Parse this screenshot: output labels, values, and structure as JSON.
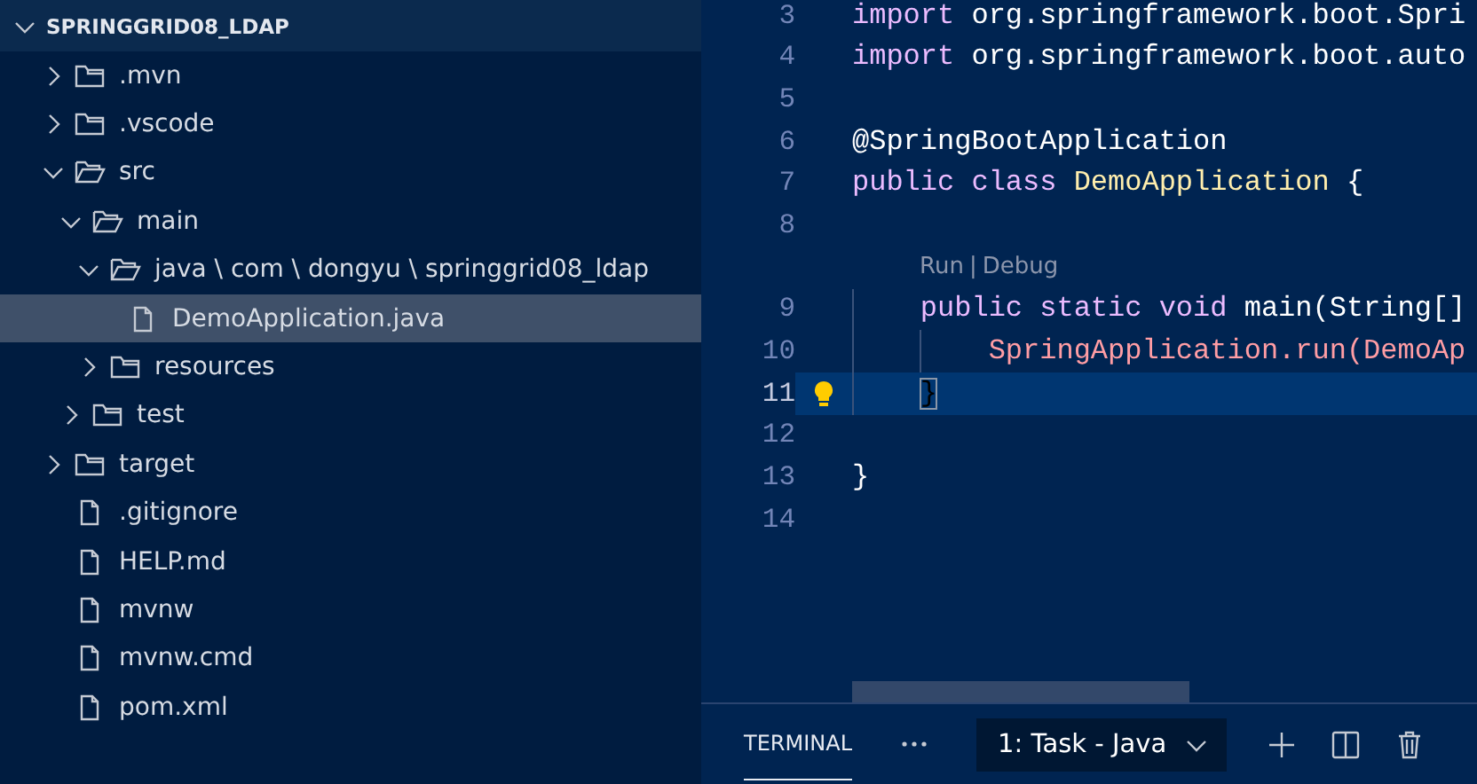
{
  "explorer": {
    "title": "SPRINGGRID08_LDAP",
    "expanded": true,
    "items": [
      {
        "kind": "folder",
        "label": ".mvn",
        "expanded": false,
        "selected": false
      },
      {
        "kind": "folder",
        "label": ".vscode",
        "expanded": false,
        "selected": false
      },
      {
        "kind": "folder",
        "label": "src",
        "expanded": true,
        "selected": false,
        "children": [
          {
            "kind": "folder",
            "label": "main",
            "expanded": true,
            "selected": false,
            "children": [
              {
                "kind": "folder",
                "label": "java \\ com \\ dongyu \\ springgrid08_ldap",
                "expanded": true,
                "selected": false,
                "children": [
                  {
                    "kind": "file",
                    "label": "DemoApplication.java",
                    "selected": true
                  }
                ]
              },
              {
                "kind": "folder",
                "label": "resources",
                "expanded": false,
                "selected": false
              }
            ]
          },
          {
            "kind": "folder",
            "label": "test",
            "expanded": false,
            "selected": false
          }
        ]
      },
      {
        "kind": "folder",
        "label": "target",
        "expanded": false,
        "selected": false
      },
      {
        "kind": "file",
        "label": ".gitignore",
        "selected": false
      },
      {
        "kind": "file",
        "label": "HELP.md",
        "selected": false
      },
      {
        "kind": "file",
        "label": "mvnw",
        "selected": false
      },
      {
        "kind": "file",
        "label": "mvnw.cmd",
        "selected": false
      },
      {
        "kind": "file",
        "label": "pom.xml",
        "selected": false
      }
    ]
  },
  "editor": {
    "lines": [
      {
        "kind": "code",
        "number": "3",
        "current": false,
        "lightbulb": false,
        "tokens": [
          {
            "kind": "keyword",
            "text": "import"
          },
          {
            "kind": "plain",
            "text": " org.springframework.boot.Spri"
          }
        ]
      },
      {
        "kind": "code",
        "number": "4",
        "current": false,
        "lightbulb": false,
        "tokens": [
          {
            "kind": "keyword",
            "text": "import"
          },
          {
            "kind": "plain",
            "text": " org.springframework.boot.auto"
          }
        ]
      },
      {
        "kind": "code",
        "number": "5",
        "current": false,
        "lightbulb": false
      },
      {
        "kind": "code",
        "number": "6",
        "current": false,
        "lightbulb": false,
        "tokens": [
          {
            "kind": "plain",
            "text": "@SpringBootApplication"
          }
        ]
      },
      {
        "kind": "code",
        "number": "7",
        "current": false,
        "lightbulb": false,
        "tokens": [
          {
            "kind": "keyword",
            "text": "public class"
          },
          {
            "kind": "class",
            "text": " DemoApplication"
          },
          {
            "kind": "plain",
            "text": " {"
          }
        ]
      },
      {
        "kind": "code",
        "number": "8",
        "current": false,
        "lightbulb": false
      },
      {
        "kind": "codelens",
        "links": [
          "Run",
          "Debug"
        ],
        "separator": "|"
      },
      {
        "kind": "code",
        "number": "9",
        "current": false,
        "lightbulb": false,
        "tokens": [
          {
            "kind": "keyword",
            "text": "    public static void"
          },
          {
            "kind": "plain",
            "text": " main(String[]"
          }
        ]
      },
      {
        "kind": "code",
        "number": "10",
        "current": false,
        "lightbulb": false,
        "tokens": [
          {
            "kind": "call",
            "text": "        SpringApplication.run(DemoAp"
          }
        ]
      },
      {
        "kind": "code",
        "number": "11",
        "current": true,
        "lightbulb": true,
        "tokens": [
          {
            "kind": "bracket-match",
            "text": "    }"
          }
        ]
      },
      {
        "kind": "code",
        "number": "12",
        "current": false,
        "lightbulb": false
      },
      {
        "kind": "code",
        "number": "13",
        "current": false,
        "lightbulb": false,
        "tokens": [
          {
            "kind": "plain",
            "text": "}"
          }
        ]
      },
      {
        "kind": "code",
        "number": "14",
        "current": false,
        "lightbulb": false
      }
    ]
  },
  "panel": {
    "tabs": [
      {
        "label": "TERMINAL",
        "selected": true
      }
    ],
    "terminal_select": {
      "value": "1: Task - Java"
    }
  }
}
